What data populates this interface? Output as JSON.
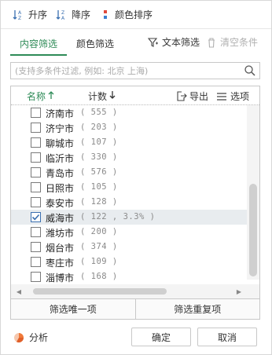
{
  "sort_toolbar": {
    "ascending_label": "升序",
    "descending_label": "降序",
    "color_sort_label": "颜色排序"
  },
  "tabs": {
    "content_filter": "内容筛选",
    "color_filter": "颜色筛选",
    "text_filter": "文本筛选",
    "clear_condition": "清空条件"
  },
  "search": {
    "placeholder": "(支持多条件过滤, 例如: 北京 上海)",
    "value": ""
  },
  "list_header": {
    "name_label": "名称",
    "count_label": "计数",
    "export_label": "导出",
    "options_label": "选项"
  },
  "items": [
    {
      "name": "济南市",
      "count": "( 555 )",
      "checked": false
    },
    {
      "name": "济宁市",
      "count": "( 203 )",
      "checked": false
    },
    {
      "name": "聊城市",
      "count": "( 107 )",
      "checked": false
    },
    {
      "name": "临沂市",
      "count": "( 330 )",
      "checked": false
    },
    {
      "name": "青岛市",
      "count": "( 576 )",
      "checked": false
    },
    {
      "name": "日照市",
      "count": "( 105 )",
      "checked": false
    },
    {
      "name": "泰安市",
      "count": "( 128 )",
      "checked": false
    },
    {
      "name": "威海市",
      "count": "( 122 , 3.3% )",
      "checked": true
    },
    {
      "name": "潍坊市",
      "count": "( 200 )",
      "checked": false
    },
    {
      "name": "烟台市",
      "count": "( 374 )",
      "checked": false
    },
    {
      "name": "枣庄市",
      "count": "( 109 )",
      "checked": false
    },
    {
      "name": "淄博市",
      "count": "( 168 )",
      "checked": false
    }
  ],
  "filter_buttons": {
    "unique": "筛选唯一项",
    "duplicate": "筛选重复项"
  },
  "footer": {
    "analyze_label": "分析",
    "ok_label": "确定",
    "cancel_label": "取消"
  },
  "colors": {
    "accent_green": "#2e8b57",
    "selected_row": "#e8ecef",
    "check_blue": "#3a6fb0",
    "analyze_orange": "#f07a3a",
    "color_sort_red": "#e04a3c",
    "color_sort_blue": "#3a7fd0"
  }
}
